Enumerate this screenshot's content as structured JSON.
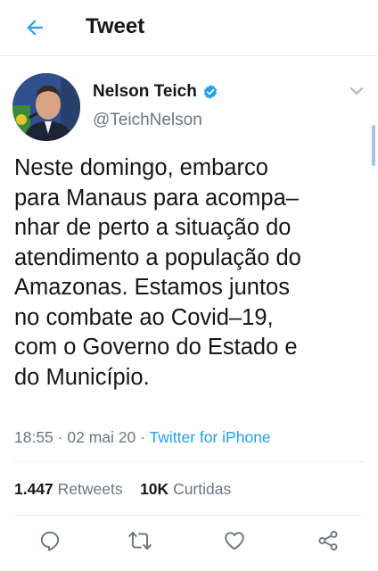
{
  "header": {
    "title": "Tweet"
  },
  "tweet": {
    "author_name": "Nelson Teich",
    "author_handle": "@TeichNelson",
    "text": "Neste domingo, embarco\npara Manaus para acompa–\nnhar de perto a situação do\natendimento a população do\nAmazonas. Estamos juntos\nno combate ao Covid–19,\ncom o Governo do Estado e\ndo Município.",
    "time": "18:55",
    "date": "02 mai 20",
    "separator": "·",
    "source": "Twitter for iPhone"
  },
  "stats": {
    "retweets_count": "1.447",
    "retweets_label": "Retweets",
    "likes_count": "10K",
    "likes_label": "Curtidas"
  },
  "colors": {
    "accent": "#1da1f2",
    "secondary_text": "#657786",
    "divider": "#e6ecf0"
  },
  "icons": [
    "back-arrow-icon",
    "verified-badge-icon",
    "chevron-down-icon",
    "reply-icon",
    "retweet-icon",
    "like-icon",
    "share-icon"
  ]
}
